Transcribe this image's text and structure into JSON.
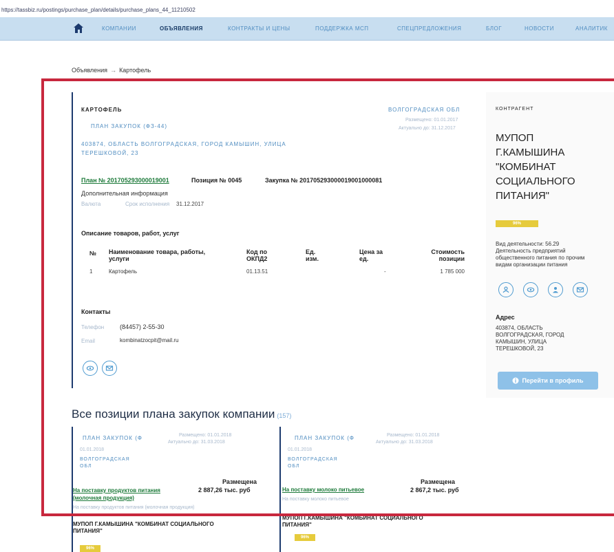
{
  "url": "https://tassbiz.ru/postings/purchase_plan/details/purchase_plans_44_11210502",
  "nav": {
    "items": [
      "КОМПАНИИ",
      "ОБЪЯВЛЕНИЯ",
      "КОНТРАКТЫ И ЦЕНЫ",
      "ПОДДЕРЖКА МСП",
      "СПЕЦПРЕДЛОЖЕНИЯ",
      "БЛОГ",
      "НОВОСТИ",
      "АНАЛИТИК"
    ],
    "active_index": 1
  },
  "breadcrumb": {
    "parent": "Объявления",
    "separator": "→",
    "current": "Картофель"
  },
  "listing": {
    "title": "КАРТОФЕЛЬ",
    "region": "ВОЛГОГРАДСКАЯ ОБЛ",
    "plan_type": "ПЛАН ЗАКУПОК (ФЗ-44)",
    "posted": "Размещено: 01.01.2017",
    "actual": "Актуально до: 31.12.2017",
    "address_line1": "403874, ОБЛАСТЬ ВОЛГОГРАДСКАЯ, ГОРОД КАМЫШИН, УЛИЦА",
    "address_line2": "ТЕРЕШКОВОЙ, 23",
    "plan_no": "План № 201705293000019001",
    "position_no": "Позиция № 0045",
    "purchase_no": "Закупка № 201705293000019001000081",
    "additional_info": "Дополнительная информация",
    "currency_label": "Валюта",
    "term_label": "Срок исполнения",
    "term_value": "31.12.2017",
    "goods_heading": "Описание товаров, работ, услуг",
    "table": {
      "headers": [
        "№",
        "Наименование товара, работы, услуги",
        "Код по ОКПД2",
        "Ед. изм.",
        "Цена за ед.",
        "Стоимость позиции"
      ],
      "rows": [
        [
          "1",
          "Картофель",
          "01.13.51",
          "",
          "-",
          "1 785 000"
        ]
      ]
    },
    "contacts_heading": "Контакты",
    "phone_label": "Телефон",
    "phone_value": "(84457) 2-55-30",
    "email_label": "Email",
    "email_value": "kombinatzocpit@mail.ru"
  },
  "contractor": {
    "label": "КОНТРАГЕНТ",
    "name_lines": [
      "МУПОП",
      "Г.КАМЫШИНА",
      "\"КОМБИНАТ",
      "СОЦИАЛЬНОГО",
      "ПИТАНИЯ\""
    ],
    "rating": "96%",
    "activity_lines": [
      "Вид деятельности: 56.29",
      "Деятельность предприятий",
      "общественного питания по прочим",
      "видам организации питания"
    ],
    "address_heading": "Адрес",
    "address_lines": [
      "403874, ОБЛАСТЬ",
      "ВОЛГОГРАДСКАЯ, ГОРОД",
      "КАМЫШИН, УЛИЦА",
      "ТЕРЕШКОВОЙ, 23"
    ],
    "profile_button": "Перейти в профиль"
  },
  "positions": {
    "title": "Все позиции плана закупок компании",
    "count": "(157)",
    "cards": [
      {
        "plan_type": "ПЛАН ЗАКУПОК (Ф",
        "posted": "Размещено: 01.01.2018",
        "actual": "Актуально до: 31.03.2018",
        "date": "01.01.2018",
        "region_lines": [
          "ВОЛГОГРАДСКАЯ",
          "ОБЛ"
        ],
        "status": "Размещена",
        "link_lines": [
          "На поставку продуктов питания",
          "(молочная продукция)"
        ],
        "amount": "2 887,26 тыс. руб",
        "subtext": "На поставку продуктов питания (молочная продукция)",
        "company_lines": [
          "МУПОП Г.КАМЫШИНА \"КОМБИНАТ СОЦИАЛЬНОГО",
          "ПИТАНИЯ\""
        ],
        "rating": "96%"
      },
      {
        "plan_type": "ПЛАН ЗАКУПОК (Ф",
        "posted": "Размещено: 01.01.2018",
        "actual": "Актуально до: 31.03.2018",
        "date": "01.01.2018",
        "region_lines": [
          "ВОЛГОГРАДСКАЯ",
          "ОБЛ"
        ],
        "status": "Размещена",
        "link_lines": [
          "На поставку молоко питьевое"
        ],
        "amount": "2 867,2 тыс. руб",
        "subtext": "На поставку молоко питьевое",
        "company_lines": [
          "МУПОП Г.КАМЫШИНА \"КОМБИНАТ СОЦИАЛЬНОГО",
          "ПИТАНИЯ\""
        ],
        "rating": "96%"
      }
    ]
  },
  "colors": {
    "accent_blue": "#4f8cc0",
    "navy": "#1c3a6e",
    "highlight_red": "#c8283e",
    "link_green": "#1d7a3a",
    "badge_yellow": "#e6cb3c",
    "button_blue": "#8ec1e8"
  },
  "icons": [
    "home-icon",
    "eye-icon",
    "mail-icon",
    "info-icon",
    "person-icon"
  ]
}
